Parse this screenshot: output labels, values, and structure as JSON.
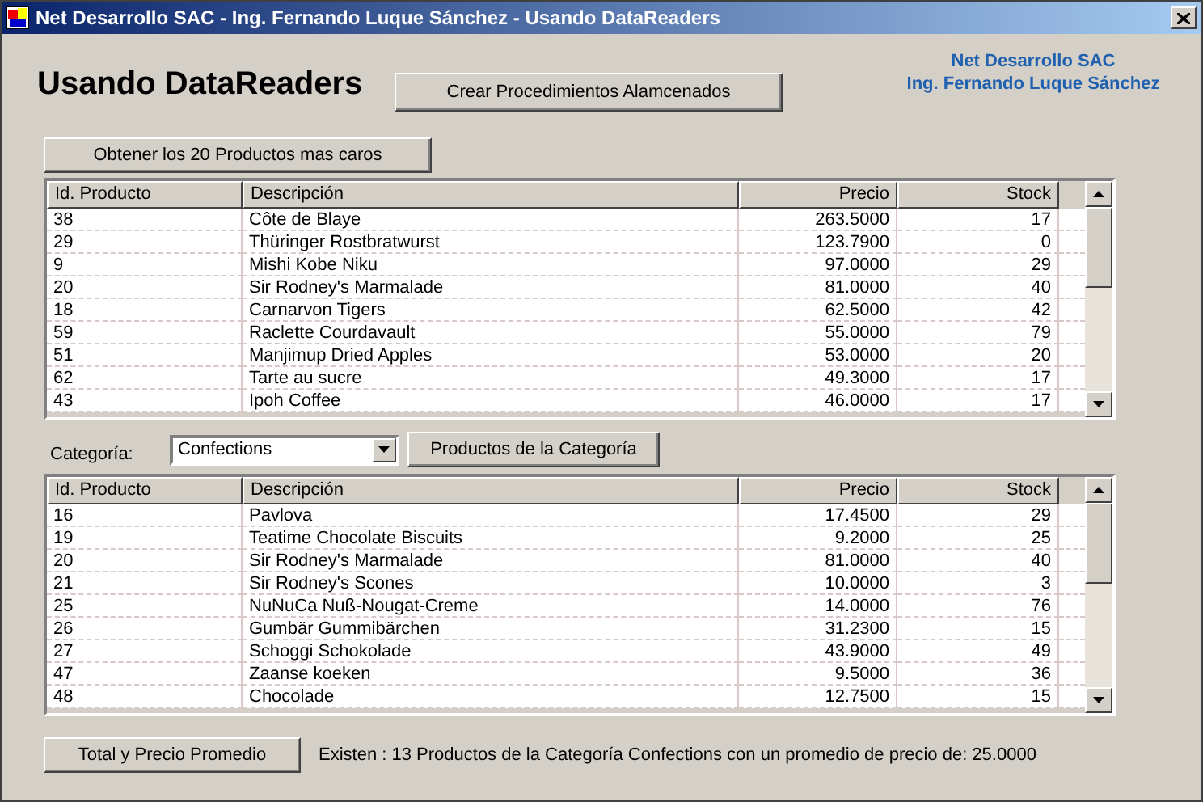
{
  "window": {
    "title": "Net Desarrollo SAC - Ing. Fernando Luque Sánchez - Usando DataReaders"
  },
  "heading": "Usando DataReaders",
  "create_button": "Crear Procedimientos Alamcenados",
  "credits": [
    "Net Desarrollo SAC",
    "Ing. Fernando Luque Sánchez"
  ],
  "top_button": "Obtener los 20 Productos mas caros",
  "top_table": {
    "columns": [
      "Id. Producto",
      "Descripción",
      "Precio",
      "Stock"
    ],
    "rows": [
      [
        "38",
        "Côte de Blaye",
        "263.5000",
        "17"
      ],
      [
        "29",
        "Thüringer Rostbratwurst",
        "123.7900",
        "0"
      ],
      [
        "9",
        "Mishi Kobe Niku",
        "97.0000",
        "29"
      ],
      [
        "20",
        "Sir Rodney's Marmalade",
        "81.0000",
        "40"
      ],
      [
        "18",
        "Carnarvon Tigers",
        "62.5000",
        "42"
      ],
      [
        "59",
        "Raclette Courdavault",
        "55.0000",
        "79"
      ],
      [
        "51",
        "Manjimup Dried Apples",
        "53.0000",
        "20"
      ],
      [
        "62",
        "Tarte au sucre",
        "49.3000",
        "17"
      ],
      [
        "43",
        "Ipoh Coffee",
        "46.0000",
        "17"
      ]
    ]
  },
  "category": {
    "label": "Categoría:",
    "value": "Confections",
    "button": "Productos de la Categoría"
  },
  "bottom_table": {
    "columns": [
      "Id. Producto",
      "Descripción",
      "Precio",
      "Stock"
    ],
    "rows": [
      [
        "16",
        "Pavlova",
        "17.4500",
        "29"
      ],
      [
        "19",
        "Teatime Chocolate Biscuits",
        "9.2000",
        "25"
      ],
      [
        "20",
        "Sir Rodney's Marmalade",
        "81.0000",
        "40"
      ],
      [
        "21",
        "Sir Rodney's Scones",
        "10.0000",
        "3"
      ],
      [
        "25",
        "NuNuCa Nuß-Nougat-Creme",
        "14.0000",
        "76"
      ],
      [
        "26",
        "Gumbär Gummibärchen",
        "31.2300",
        "15"
      ],
      [
        "27",
        "Schoggi Schokolade",
        "43.9000",
        "49"
      ],
      [
        "47",
        "Zaanse koeken",
        "9.5000",
        "36"
      ],
      [
        "48",
        "Chocolade",
        "12.7500",
        "15"
      ]
    ]
  },
  "total_button": "Total y Precio Promedio",
  "result": "Existen : 13 Productos de la Categoría Confections con un promedio de precio de: 25.0000"
}
